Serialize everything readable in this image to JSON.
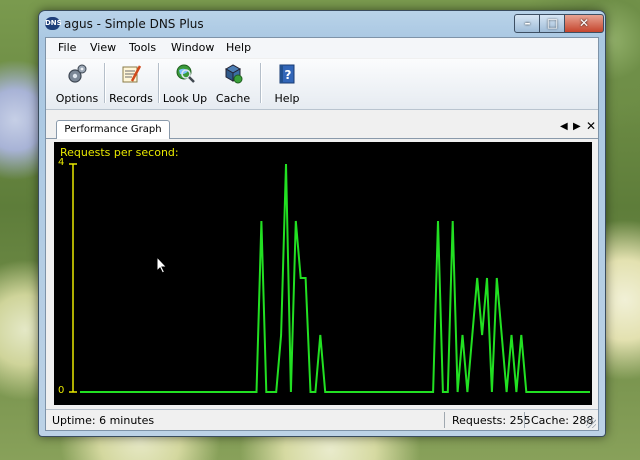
{
  "window": {
    "title": "agus - Simple DNS Plus",
    "app_badge": "DNS"
  },
  "menu": [
    "File",
    "View",
    "Tools",
    "Window",
    "Help"
  ],
  "toolbar": [
    {
      "label": "Options",
      "icon": "gears-icon"
    },
    {
      "label": "Records",
      "icon": "records-icon"
    },
    {
      "label": "Look Up",
      "icon": "globe-magnifier-icon"
    },
    {
      "label": "Cache",
      "icon": "cache-icon"
    },
    {
      "label": "Help",
      "icon": "help-book-icon"
    }
  ],
  "tab": {
    "label": "Performance Graph"
  },
  "chart_data": {
    "type": "line",
    "title": "Requests per second:",
    "ylim": [
      0,
      4
    ],
    "yticks": [
      "4",
      "0"
    ],
    "series": [
      {
        "color": "#22e022",
        "values": [
          0,
          0,
          0,
          0,
          0,
          0,
          0,
          0,
          0,
          0,
          0,
          0,
          0,
          0,
          0,
          0,
          0,
          0,
          0,
          0,
          0,
          0,
          0,
          0,
          0,
          0,
          0,
          0,
          0,
          0,
          0,
          0,
          0,
          0,
          0,
          0,
          0,
          3,
          0,
          0,
          0,
          1,
          4,
          0,
          3,
          2,
          2,
          0,
          0,
          1,
          0,
          0,
          0,
          0,
          0,
          0,
          0,
          0,
          0,
          0,
          0,
          0,
          0,
          0,
          0,
          0,
          0,
          0,
          0,
          0,
          0,
          0,
          0,
          3,
          0,
          0,
          3,
          0,
          1,
          0,
          1,
          2,
          1,
          2,
          0,
          2,
          1,
          0,
          1,
          0,
          1,
          0,
          0,
          0,
          0,
          0,
          0,
          0,
          0,
          0,
          0,
          0,
          0,
          0,
          0
        ]
      }
    ]
  },
  "status": {
    "uptime": "Uptime: 6 minutes",
    "requests": "Requests: 255",
    "cache": "Cache: 288"
  }
}
